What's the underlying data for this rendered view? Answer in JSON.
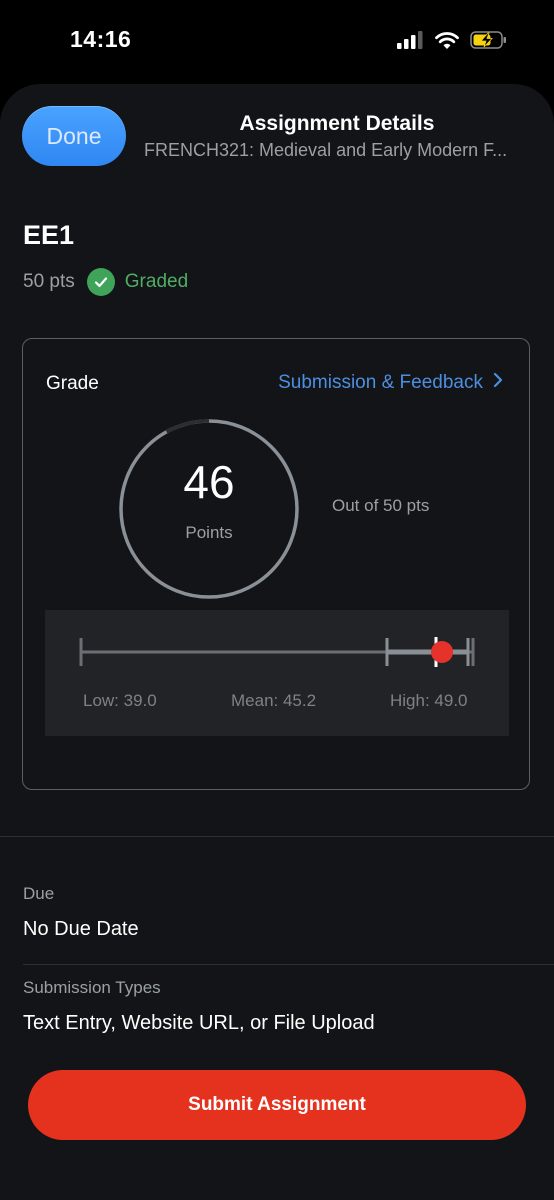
{
  "status_bar": {
    "time": "14:16"
  },
  "header": {
    "done_label": "Done",
    "title": "Assignment Details",
    "subtitle": "FRENCH321: Medieval and Early Modern F..."
  },
  "assignment": {
    "name": "EE1",
    "points": "50 pts",
    "status": "Graded"
  },
  "grade_card": {
    "label": "Grade",
    "link_label": "Submission & Feedback",
    "score": "46",
    "score_unit": "Points",
    "out_of": "Out of 50 pts",
    "score_fraction": 0.92,
    "stats": {
      "low_label": "Low: 39.0",
      "mean_label": "Mean: 45.2",
      "high_label": "High: 49.0"
    }
  },
  "details": {
    "due_label": "Due",
    "due_value": "No Due Date",
    "submission_types_label": "Submission Types",
    "submission_types_value": "Text Entry, Website URL, or File Upload"
  },
  "submit_label": "Submit Assignment",
  "colors": {
    "accent_blue": "#4d8fdf",
    "done_button": "#3b95fa",
    "graded_green": "#3fa45a",
    "submit_red": "#e5321f",
    "score_marker": "#e5322b"
  },
  "icons": {
    "signal": "cellular-signal-icon",
    "wifi": "wifi-icon",
    "battery": "battery-charging-icon",
    "graded": "checkmark-circle-icon",
    "link_chevron": "chevron-right-icon"
  }
}
